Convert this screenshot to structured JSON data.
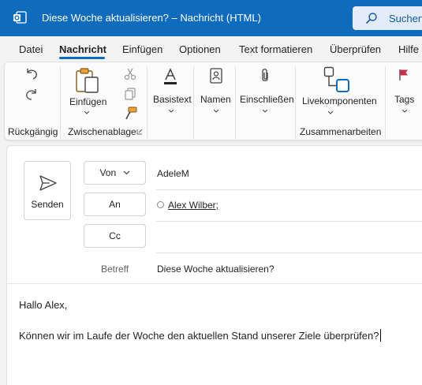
{
  "window": {
    "title": "Diese Woche aktualisieren? – Nachricht (HTML)",
    "search_label": "Suchen",
    "accent": "#0f6cbd"
  },
  "tabs": [
    {
      "label": "Datei"
    },
    {
      "label": "Nachricht",
      "active": true
    },
    {
      "label": "Einfügen"
    },
    {
      "label": "Optionen"
    },
    {
      "label": "Text formatieren"
    },
    {
      "label": "Überprüfen"
    },
    {
      "label": "Hilfe"
    }
  ],
  "ribbon": {
    "undo_group": "Rückgängig",
    "paste_label": "Einfügen",
    "clipboard_group": "Zwischenablage",
    "basic_text": "Basistext",
    "names": "Namen",
    "include": "Einschließen",
    "live_components": "Livekomponenten",
    "collab_group": "Zusammenarbeiten",
    "tags": "Tags"
  },
  "compose": {
    "send_label": "Senden",
    "from_label": "Von",
    "from_value": "AdeleM",
    "to_label": "An",
    "to_value": "Alex Wilber;",
    "cc_label": "Cc",
    "subject_label": "Betreff",
    "subject_value": "Diese Woche aktualisieren?"
  },
  "body": {
    "greeting": "Hallo Alex,",
    "line1": "Können wir im Laufe der Woche den aktuellen Stand unserer Ziele überprüfen?"
  }
}
